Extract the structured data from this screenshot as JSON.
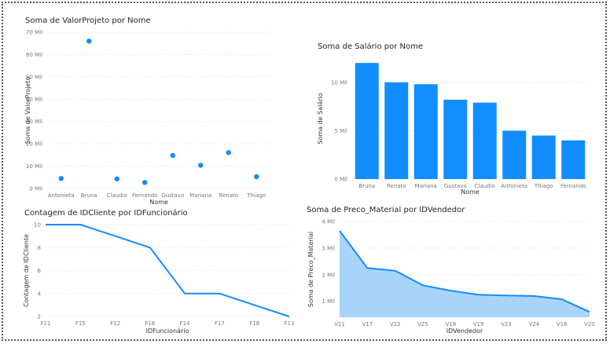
{
  "chart_data": [
    {
      "type": "scatter",
      "title": "Soma de ValorProjeto por Nome",
      "xlabel": "Nome",
      "ylabel": "Soma de ValorProjeto",
      "categories": [
        "Antonieta",
        "Bruna",
        "Claudio",
        "Fernando",
        "Gustavo",
        "Mariana",
        "Renato",
        "Thiago"
      ],
      "values": [
        4.5,
        66,
        4.3,
        2.7,
        14.8,
        10.4,
        16.1,
        5.3
      ],
      "yticks": [
        0,
        10,
        20,
        30,
        40,
        50,
        60,
        70
      ],
      "ytick_labels": [
        "0 Mil",
        "10 Mil",
        "20 Mil",
        "30 Mil",
        "40 Mil",
        "50 Mil",
        "60 Mil",
        "70 Mil"
      ],
      "ylim": [
        0,
        70
      ],
      "grid": true,
      "color": "#118DFF"
    },
    {
      "type": "bar",
      "title": "Soma de Salário por Nome",
      "xlabel": "Nome",
      "ylabel": "Soma de Salário",
      "categories": [
        "Bruna",
        "Renato",
        "Mariana",
        "Gustavo",
        "Claudio",
        "Antonieta",
        "Thiago",
        "Fernando"
      ],
      "values": [
        12.0,
        10.0,
        9.8,
        8.2,
        7.9,
        5.0,
        4.5,
        4.0
      ],
      "yticks": [
        0,
        5,
        10
      ],
      "ytick_labels": [
        "0 Mil",
        "5 Mil",
        "10 Mil"
      ],
      "ylim": [
        0,
        12.5
      ],
      "grid": true,
      "color": "#118DFF"
    },
    {
      "type": "line",
      "title": "Contagem de IDCliente por IDFuncionário",
      "xlabel": "IDFuncionário",
      "ylabel": "Contagem de IDCliente",
      "categories": [
        "F11",
        "F15",
        "F12",
        "F16",
        "F14",
        "F17",
        "F18",
        "F13"
      ],
      "values": [
        10,
        10,
        9,
        8,
        4,
        4,
        3,
        2
      ],
      "yticks": [
        2,
        4,
        6,
        8,
        10
      ],
      "ytick_labels": [
        "2",
        "4",
        "6",
        "8",
        "10"
      ],
      "ylim": [
        2,
        10
      ],
      "grid": true,
      "color": "#118DFF"
    },
    {
      "type": "area",
      "title": "Soma de Preco_Material por IDVendedor",
      "xlabel": "IDVendedor",
      "ylabel": "Soma de Preco_Material",
      "categories": [
        "V21",
        "V17",
        "V22",
        "V25",
        "V18",
        "V19",
        "V23",
        "V24",
        "V16",
        "V20"
      ],
      "values": [
        3.65,
        2.25,
        2.15,
        1.6,
        1.4,
        1.25,
        1.22,
        1.2,
        1.08,
        0.6
      ],
      "yticks": [
        1,
        2,
        3,
        4
      ],
      "ytick_labels": [
        "1 Mil",
        "2 Mil",
        "3 Mil",
        "4 Mil"
      ],
      "ylim": [
        0.4,
        4
      ],
      "grid": true,
      "color": "#118DFF",
      "fill": "#A9D4FA"
    }
  ]
}
